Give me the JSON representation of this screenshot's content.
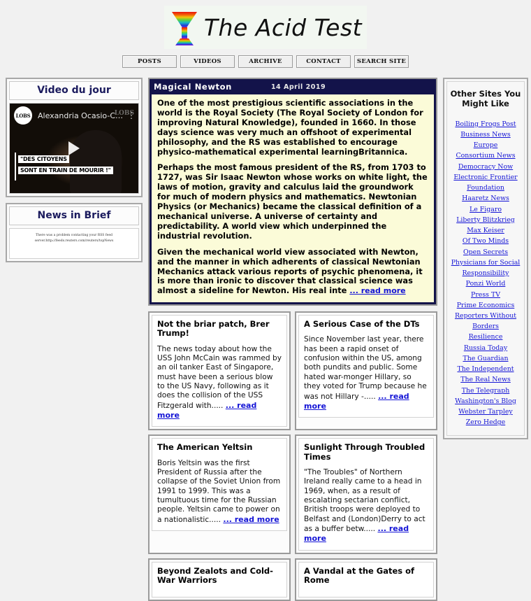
{
  "site": {
    "title": "The Acid Test",
    "logo_icon": "rainbow-cocktail-glass-icon"
  },
  "nav": {
    "items": [
      {
        "label": "POSTS",
        "name": "nav-posts"
      },
      {
        "label": "VIDEOS",
        "name": "nav-videos"
      },
      {
        "label": "ARCHIVE",
        "name": "nav-archive"
      },
      {
        "label": "CONTACT",
        "name": "nav-contact"
      },
      {
        "label": "SEARCH SITE",
        "name": "nav-search-site"
      }
    ]
  },
  "sidebar_left": {
    "video_widget": {
      "heading": "Video du jour",
      "channel_avatar": "LOBS",
      "video_title": "Alexandria Ocasio-Cor...",
      "watermark": "LOBS",
      "caption_line1": "\"DES CITOYENS",
      "caption_line2": "SONT EN TRAIN DE MOURIR !\"",
      "play_icon": "play-icon",
      "menu_icon": "kebab-menu-icon"
    },
    "news_brief": {
      "heading": "News in Brief",
      "error_line1": "There was a problem contacting your RSS feed",
      "error_line2": "server.http://feeds.reuters.com/reuters/topNews"
    }
  },
  "feature": {
    "title": "Magical Newton",
    "date": "14 April 2019",
    "paragraphs": [
      "One of the most prestigious scientific associations in the world is the Royal Society (The Royal Society of London for improving Natural Knowledge), founded in 1660. In those days science was very much an offshoot of experimental philosophy, and the RS was established to encourage physico-mathematical experimental learningBritannica.",
      "Perhaps the most famous president of the RS, from 1703 to 1727, was Sir Isaac Newton whose works on white light, the laws of motion, gravity and calculus laid the groundwork for much of modern physics and mathematics. Newtonian Physics (or Mechanics) became the classical definition of a mechanical universe. A universe of certainty and predictability. A world view which underpinned the industrial revolution.",
      "Given the mechanical world view associated with Newton, and the manner in which adherents of classical Newtonian Mechanics attack various reports of psychic phenomena, it is more than ironic to discover that classical science was almost a sideline for Newton. His real inte"
    ],
    "read_more": "... read more"
  },
  "cards": [
    {
      "title": "Not the briar patch, Brer Trump!",
      "text": "The news today about how the USS John McCain was rammed by an oil tanker East of Singapore, must have been a serious blow to the US Navy, following as it does the collision of the USS Fitzgerald with.....",
      "read_more": "... read more"
    },
    {
      "title": "A Serious Case of the DTs",
      "text": "Since November last year, there has been a rapid onset of confusion within the US, among both pundits and public. Some hated war-monger Hillary, so they voted for Trump because he was not Hillary -.....",
      "read_more": "... read more"
    },
    {
      "title": "The American Yeltsin",
      "text": "Boris Yeltsin was the first President of Russia after the collapse of the Soviet Union from 1991 to 1999. This was a tumultuous time for the Russian people. Yeltsin came to power on a nationalistic.....",
      "read_more": "... read more"
    },
    {
      "title": "Sunlight Through Troubled Times",
      "text": "\"The Troubles\" of Northern Ireland really came to a head in 1969, when, as a result of escalating sectarian conflict, British troops were deployed to Belfast and (London)Derry to act as a buffer betw.....",
      "read_more": "... read more"
    },
    {
      "title": "Beyond Zealots and Cold-War Warriors",
      "text": "",
      "read_more": ""
    },
    {
      "title": "A Vandal at the Gates of Rome",
      "text": "",
      "read_more": ""
    }
  ],
  "sidebar_right": {
    "heading_line1": "Other Sites You",
    "heading_line2": "Might Like",
    "links": [
      "Boiling Frogs Post",
      "Business News Europe",
      "Consortium News",
      "Democracy Now",
      "Electronic Frontier Foundation",
      "Haaretz News",
      "Le Figaro",
      "Liberty Blitzkrieg",
      "Max Keiser",
      "Of Two Minds",
      "Open Secrets",
      "Physicians for Social Responsibility",
      "Ponzi World",
      "Press TV",
      "Prime Economics",
      "Reporters Without Borders",
      "Resilience",
      "Russia Today",
      "The Guardian",
      "The Independent",
      "The Real News",
      "The Telegraph",
      "Washington's Blog",
      "Webster Tarpley",
      "Zero Hedge"
    ]
  },
  "colors": {
    "page_background": "#f1f1f1",
    "feature_header": "#13134a",
    "feature_body": "#fbfbd8",
    "link": "#1414d6",
    "heading": "#1b1b5e"
  }
}
